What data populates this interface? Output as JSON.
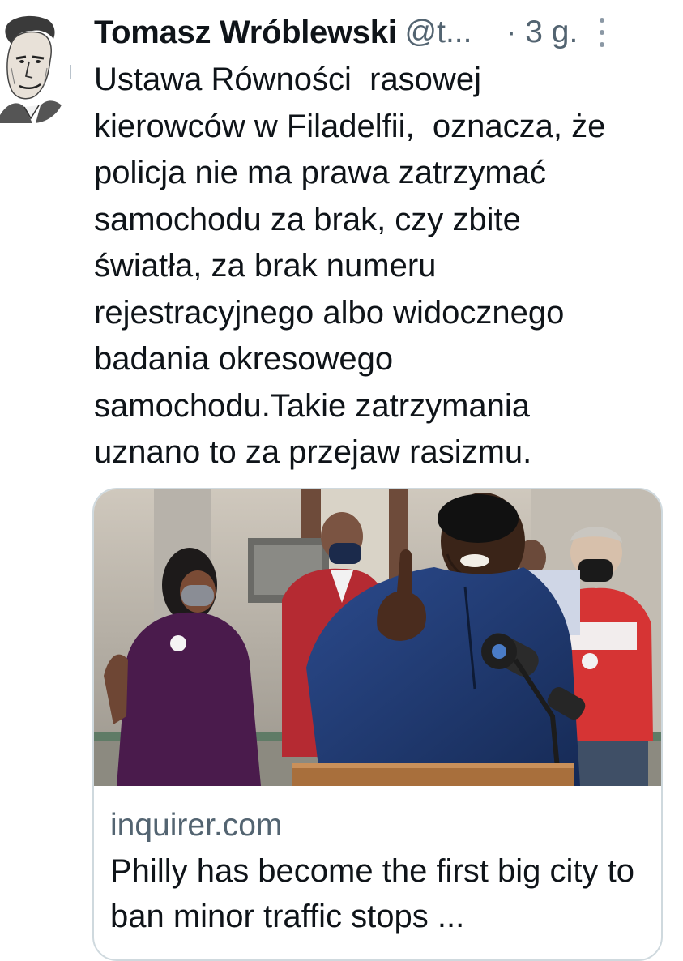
{
  "tweet": {
    "author_name": "Tomasz Wróblewski",
    "author_handle": "@t...",
    "timestamp": "· 3 g.",
    "text": "Ustawa Równości  rasowej\nkierowców w Filadelfii,  oznacza, że\npolicja nie ma prawa zatrzymać\nsamochodu za brak, czy zbite\nświatła, za brak numeru\nrejestracyjnego albo widocznego\nbadania okresowego\nsamochodu.Takie zatrzymania\nuznano to za przejaw rasizmu.",
    "more_icon": "vertical-ellipsis-icon"
  },
  "link_card": {
    "domain": "inquirer.com",
    "title": "Philly has become the first big city to ban minor traffic stops ...",
    "image_description_icon": "photo"
  },
  "colors": {
    "text_primary": "#0f1419",
    "text_secondary": "#536471",
    "border": "#cfd9de"
  }
}
